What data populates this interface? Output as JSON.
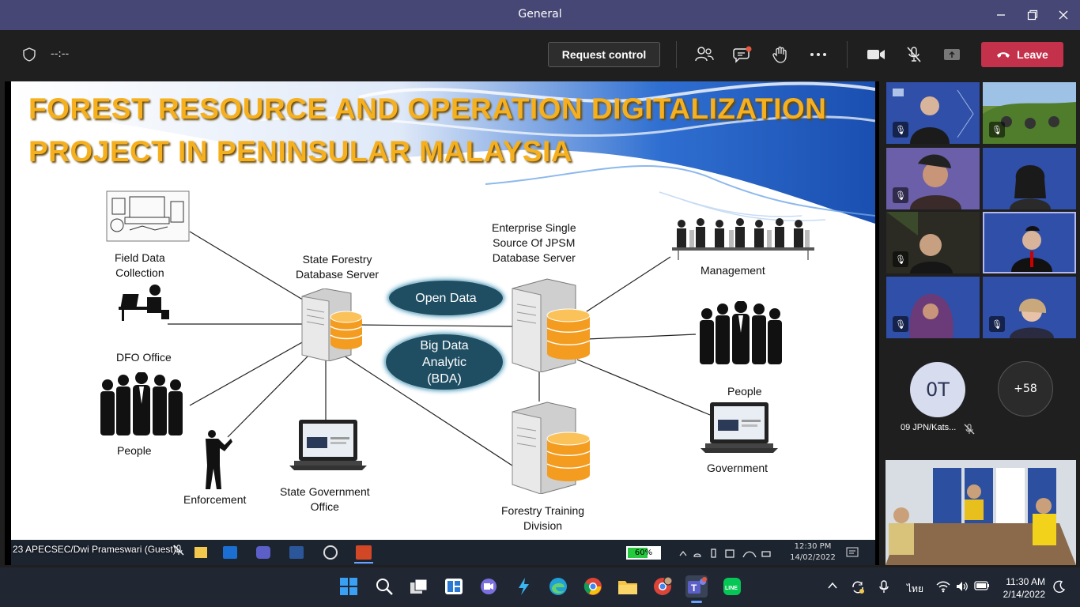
{
  "window": {
    "title": "General"
  },
  "meeting_toolbar": {
    "timer": "--:--",
    "request_control": "Request control",
    "leave": "Leave"
  },
  "slide": {
    "title_line1": "FOREST RESOURCE AND OPERATION DIGITALIZATION",
    "title_line2": "PROJECT IN PENINSULAR MALAYSIA",
    "nodes": {
      "field_data": "Field Data\nCollection",
      "dfo_office": "DFO Office",
      "people_left": "People",
      "enforcement": "Enforcement",
      "state_gov_office": "State Government\nOffice",
      "state_forestry_server": "State Forestry\nDatabase Server",
      "enterprise_server": "Enterprise Single\nSource Of JPSM\nDatabase Server",
      "forestry_training": "Forestry Training\nDivision",
      "management": "Management",
      "people_right": "People",
      "government": "Government"
    },
    "bubbles": {
      "open_data": "Open Data",
      "big_data": "Big Data\nAnalytic\n(BDA)"
    }
  },
  "shared_screen_taskbar": {
    "presenter_label": "23 APECSEC/Dwi Prameswari (Guest)",
    "battery": "60%",
    "battery_level": 0.6,
    "time": "12:30 PM",
    "date": "14/02/2022"
  },
  "participants": {
    "initials_avatar": "0T",
    "initials_name": "09 JPN/Kats...",
    "overflow_count": "+58"
  },
  "windows_taskbar": {
    "language": "ไทย",
    "time": "11:30 AM",
    "date": "2/14/2022"
  },
  "colors": {
    "titlebar": "#464775",
    "leave": "#c4314b",
    "slide_title": "#f6b01e",
    "bubble": "#1f4e63",
    "server_orange": "#f39c1f"
  }
}
